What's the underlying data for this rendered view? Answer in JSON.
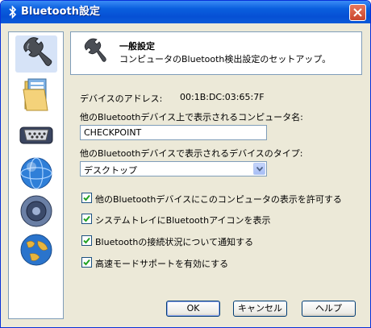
{
  "window": {
    "title": "Bluetooth設定",
    "title_icon": "bluetooth-icon"
  },
  "sidebar": {
    "items": [
      {
        "icon": "wrench-icon",
        "selected": true
      },
      {
        "icon": "folder-icon",
        "selected": false
      },
      {
        "icon": "serial-port-icon",
        "selected": false
      },
      {
        "icon": "globe-icon",
        "selected": false
      },
      {
        "icon": "speaker-icon",
        "selected": false
      },
      {
        "icon": "globe-network-icon",
        "selected": false
      }
    ]
  },
  "header": {
    "title": "一般設定",
    "description": "コンピュータのBluetooth検出設定のセットアップ。",
    "icon": "wrench-icon"
  },
  "device_address": {
    "label": "デバイスのアドレス:",
    "value": "00:1B:DC:03:65:7F"
  },
  "computer_name": {
    "label": "他のBluetoothデバイス上で表示されるコンピュータ名:",
    "value": "CHECKPOINT"
  },
  "device_type": {
    "label": "他のBluetoothデバイスで表示されるデバイスのタイプ:",
    "selected": "デスクトップ"
  },
  "options": [
    {
      "label": "他のBluetoothデバイスにこのコンピュータの表示を許可する",
      "checked": true
    },
    {
      "label": "システムトレイにBluetoothアイコンを表示",
      "checked": true
    },
    {
      "label": "Bluetoothの接続状況について通知する",
      "checked": true
    },
    {
      "label": "高速モードサポートを有効にする",
      "checked": true
    }
  ],
  "buttons": {
    "ok": "OK",
    "cancel": "キャンセル",
    "help": "ヘルプ"
  },
  "colors": {
    "titlebar": "#0a5fde",
    "panel_bg": "#ece9d8",
    "checkmark": "#21a121"
  }
}
